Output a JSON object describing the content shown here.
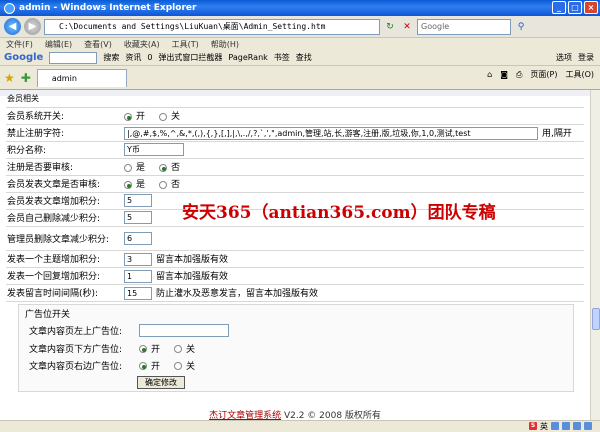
{
  "window": {
    "title": "admin - Windows Internet Explorer"
  },
  "address": {
    "url": "C:\\Documents and Settings\\LiuKuan\\桌面\\Admin_Setting.htm",
    "search_placeholder": "Google"
  },
  "menubar": {
    "items": [
      "文件(F)",
      "编辑(E)",
      "查看(V)",
      "收藏夹(A)",
      "工具(T)",
      "帮助(H)"
    ],
    "options": "选项",
    "login": "登录"
  },
  "googlebar": {
    "logo": "Google",
    "search_label": "搜索",
    "news": "资讯",
    "pagerank": "PageRank",
    "bookmark": "书签",
    "blocked": "弹出式窗口拦截器",
    "check": "查找",
    "number": "0"
  },
  "tab": {
    "title": "admin",
    "page": "页面(P)",
    "tools": "工具(O)"
  },
  "form": {
    "section_title": "会员相关",
    "rows": [
      {
        "label": "会员系统开关:",
        "type": "radio",
        "opt1": "开",
        "opt2": "关",
        "checked": 1
      },
      {
        "label": "禁止注册字符:",
        "type": "text",
        "value": "|,@,#,$,%,^,&,*,(,),{,},[,],|,\\,.,/,?,`,',\",admin,管理,站,长,游客,注册,版,垃圾,你,1,0,测试,test",
        "note": "用,隔开"
      },
      {
        "label": "积分名称:",
        "type": "text",
        "value": "Y币"
      },
      {
        "label": "注册是否要审核:",
        "type": "radio",
        "opt1": "是",
        "opt2": "否",
        "checked": 2
      },
      {
        "label": "会员发表文章是否审核:",
        "type": "radio",
        "opt1": "是",
        "opt2": "否",
        "checked": 1
      },
      {
        "label": "会员发表文章增加积分:",
        "type": "text",
        "value": "5"
      },
      {
        "label": "会员自己删除减少积分:",
        "type": "text",
        "value": "5"
      },
      {
        "label": "管理员删除文章减少积分:",
        "type": "text",
        "value": "6"
      },
      {
        "label": "发表一个主题增加积分:",
        "type": "text",
        "value": "3",
        "note": "留言本加强版有效"
      },
      {
        "label": "发表一个回复增加积分:",
        "type": "text",
        "value": "1",
        "note": "留言本加强版有效"
      },
      {
        "label": "发表留言时间间隔(秒):",
        "type": "text",
        "value": "15",
        "note": "防止灌水及恶意发言，留言本加强版有效"
      }
    ]
  },
  "ads": {
    "title": "广告位开关",
    "top_label": "文章内容页左上广告位:",
    "bottom_label": "文章内容页下方广告位:",
    "right_label": "文章内容页右边广告位:",
    "on": "开",
    "off": "关",
    "submit": "确定修改"
  },
  "footer": {
    "link": "杰订文章管理系统",
    "version": "V2.2 © 2008 版权所有"
  },
  "watermark": "安天365（antian365.com）团队专稿",
  "status": {
    "lang": "英"
  }
}
